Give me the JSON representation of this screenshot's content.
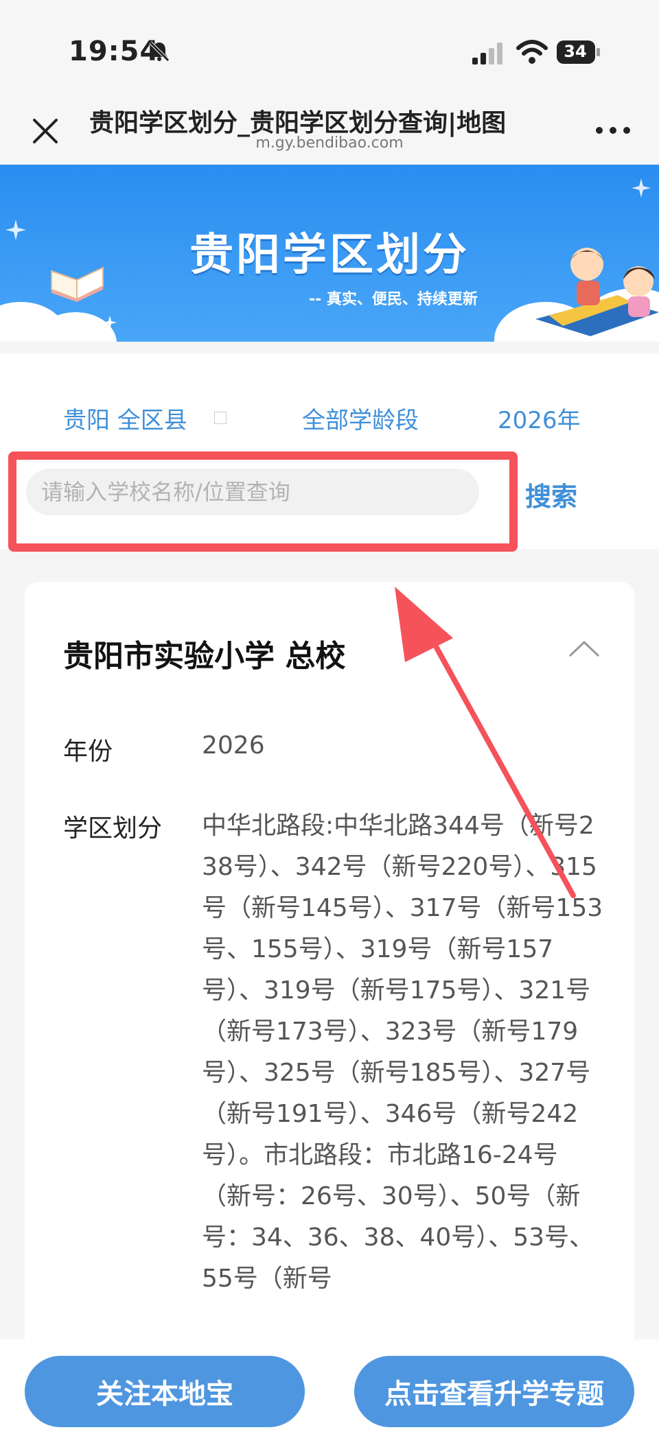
{
  "status": {
    "time": "19:54",
    "battery": "34"
  },
  "nav": {
    "title": "贵阳学区划分_贵阳学区划分查询|地图",
    "url": "m.gy.bendibao.com"
  },
  "banner": {
    "title": "贵阳学区划分",
    "subtitle": "-- 真实、便民、持续更新"
  },
  "filter": {
    "region": "贵阳 全区县",
    "stage": "全部学龄段",
    "year": "2026年"
  },
  "search": {
    "placeholder": "请输入学校名称/位置查询",
    "button": "搜索"
  },
  "school": {
    "name": "贵阳市实验小学 总校",
    "year_label": "年份",
    "year_value": "2026",
    "district_label": "学区划分",
    "district_value": "中华北路段:中华北路344号（新号238号）、342号（新号220号）、315号（新号145号）、317号（新号153号、155号）、319号（新号157号）、319号（新号175号）、321号（新号173号）、323号（新号179号）、325号（新号185号）、327号（新号191号）、346号（新号242号）。市北路段：市北路16-24号（新号：26号、30号）、50号（新号：34、36、38、40号）、53号、55号（新号"
  },
  "bottom": {
    "follow": "关注本地宝",
    "topic": "点击查看升学专题"
  },
  "colors": {
    "accent": "#3f8fd8",
    "highlight": "#f5525a",
    "button": "#4f96e0"
  }
}
